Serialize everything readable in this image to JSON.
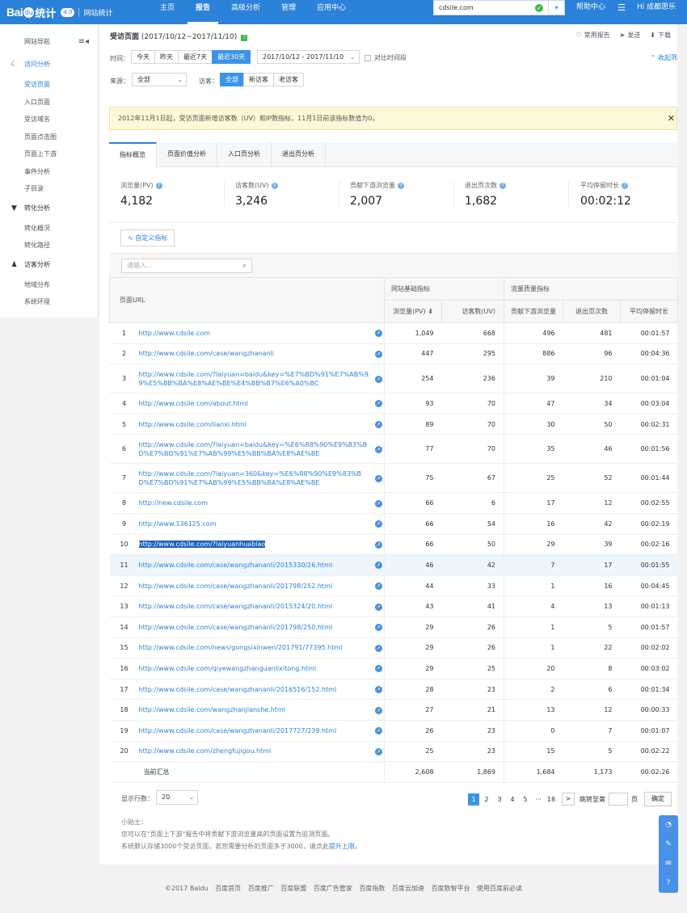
{
  "brand": {
    "bai": "Bai",
    "paw": "du",
    "tongji": "统计",
    "version": "4.0",
    "sub": "网站统计"
  },
  "topnav": [
    {
      "label": "主页"
    },
    {
      "label": "报告",
      "active": true
    },
    {
      "label": "高级分析"
    },
    {
      "label": "管理"
    },
    {
      "label": "应用中心"
    }
  ],
  "site": {
    "value": "cdsile.com"
  },
  "help": "帮助中心",
  "greeting": "Hi 成都思乐",
  "sidebar": {
    "title": "网站导航",
    "groups": [
      {
        "label": "访问分析",
        "icon": "moon-icon",
        "items": [
          "受访页面",
          "入口页面",
          "受访域名",
          "页面点击图",
          "页面上下游",
          "事件分析",
          "子目录"
        ]
      },
      {
        "label": "转化分析",
        "icon": "funnel-icon",
        "items": [
          "转化概况",
          "转化路径"
        ]
      },
      {
        "label": "访客分析",
        "icon": "user-icon",
        "items": [
          "地域分布",
          "系统环境"
        ]
      }
    ]
  },
  "header": {
    "title": "受访页面",
    "range": "(2017/10/12~2017/11/10)",
    "actions": [
      "常用报告",
      "发送",
      "下载"
    ],
    "collapse": "收起筛",
    "time_label": "时间：",
    "time_buttons": [
      "今天",
      "昨天",
      "最近7天",
      "最近30天"
    ],
    "date_range": "2017/10/12 - 2017/11/10",
    "compare": "对比时间段",
    "source_label": "来源：",
    "source_value": "全部",
    "visitor_label": "访客：",
    "visitor_buttons": [
      "全部",
      "新访客",
      "老访客"
    ]
  },
  "notice": "2012年11月1日起，受访页面新增访客数（UV）和IP数指标，11月1日前该指标数值为0。",
  "tabs": [
    "指标概览",
    "页面价值分析",
    "入口页分析",
    "退出页分析"
  ],
  "metrics": [
    {
      "label": "浏览量(PV)",
      "value": "4,182"
    },
    {
      "label": "访客数(UV)",
      "value": "3,246"
    },
    {
      "label": "贡献下游浏览量",
      "value": "2,007"
    },
    {
      "label": "退出页次数",
      "value": "1,682"
    },
    {
      "label": "平均停留时长",
      "value": "00:02:12"
    }
  ],
  "custom_metric": "自定义指标",
  "search_placeholder": "请输入...",
  "table": {
    "col_url": "页面URL",
    "group1": "网站基础指标",
    "group2": "流量质量指标",
    "cols": [
      "浏览量(PV)",
      "访客数(UV)",
      "贡献下游浏览量",
      "退出页次数",
      "平均停留时长"
    ],
    "rows": [
      {
        "idx": "1",
        "url": "http://www.cdsile.com",
        "pv": "1,049",
        "uv": "668",
        "down": "496",
        "exit": "481",
        "time": "00:01:57"
      },
      {
        "idx": "2",
        "url": "http://www.cdsile.com/case/wangzhananli",
        "pv": "447",
        "uv": "295",
        "down": "886",
        "exit": "96",
        "time": "00:04:36"
      },
      {
        "idx": "3",
        "url": "http://www.cdsile.com/?laiyuan=baidu&key=%E7%BD%91%E7%AB%99%E5%BB%BA%E8%AE%BE%E4%BB%B7%E6%A0%BC",
        "pv": "254",
        "uv": "236",
        "down": "39",
        "exit": "210",
        "time": "00:01:04"
      },
      {
        "idx": "4",
        "url": "http://www.cdsile.com/about.html",
        "pv": "93",
        "uv": "70",
        "down": "47",
        "exit": "34",
        "time": "00:03:04"
      },
      {
        "idx": "5",
        "url": "http://www.cdsile.com/lianxi.html",
        "pv": "89",
        "uv": "70",
        "down": "30",
        "exit": "50",
        "time": "00:02:31"
      },
      {
        "idx": "6",
        "url": "http://www.cdsile.com/?laiyuan=baidu&key=%E6%88%90%E9%83%BD%E7%BD%91%E7%AB%99%E5%BB%BA%E8%AE%BE",
        "pv": "77",
        "uv": "70",
        "down": "35",
        "exit": "46",
        "time": "00:01:56"
      },
      {
        "idx": "7",
        "url": "http://www.cdsile.com/?laiyuan=360&key=%E6%88%90%E9%83%BD%E7%BD%91%E7%AB%99%E5%BB%BA%E8%AE%BE",
        "pv": "75",
        "uv": "67",
        "down": "25",
        "exit": "52",
        "time": "00:01:44"
      },
      {
        "idx": "8",
        "url": "http://new.cdsile.com",
        "pv": "66",
        "uv": "6",
        "down": "17",
        "exit": "12",
        "time": "00:02:55"
      },
      {
        "idx": "9",
        "url": "http://www.136125.com",
        "pv": "66",
        "uv": "54",
        "down": "16",
        "exit": "42",
        "time": "00:02:19"
      },
      {
        "idx": "10",
        "url": "http://www.cdsile.com/?laiyuanhuabiao",
        "pv": "66",
        "uv": "50",
        "down": "29",
        "exit": "39",
        "time": "00:02:16"
      },
      {
        "idx": "11",
        "url": "http://www.cdsile.com/case/wangzhananli/2015330/26.html",
        "pv": "46",
        "uv": "42",
        "down": "7",
        "exit": "17",
        "time": "00:01:55"
      },
      {
        "idx": "12",
        "url": "http://www.cdsile.com/case/wangzhananli/201798/252.html",
        "pv": "44",
        "uv": "33",
        "down": "1",
        "exit": "16",
        "time": "00:04:45"
      },
      {
        "idx": "13",
        "url": "http://www.cdsile.com/case/wangzhananli/2015324/20.html",
        "pv": "43",
        "uv": "41",
        "down": "4",
        "exit": "13",
        "time": "00:01:13"
      },
      {
        "idx": "14",
        "url": "http://www.cdsile.com/case/wangzhananli/201798/250.html",
        "pv": "29",
        "uv": "26",
        "down": "1",
        "exit": "5",
        "time": "00:01:57"
      },
      {
        "idx": "15",
        "url": "http://www.cdsile.com/news/gongsixinwen/201791/77395.html",
        "pv": "29",
        "uv": "26",
        "down": "1",
        "exit": "22",
        "time": "00:02:02"
      },
      {
        "idx": "16",
        "url": "http://www.cdsile.com/qiyewangzhanguanlixitong.html",
        "pv": "29",
        "uv": "25",
        "down": "20",
        "exit": "8",
        "time": "00:03:02"
      },
      {
        "idx": "17",
        "url": "http://www.cdsile.com/case/wangzhananli/2016516/152.html",
        "pv": "28",
        "uv": "23",
        "down": "2",
        "exit": "6",
        "time": "00:01:34"
      },
      {
        "idx": "18",
        "url": "http://www.cdsile.com/wangzhanjianshe.html",
        "pv": "27",
        "uv": "21",
        "down": "13",
        "exit": "12",
        "time": "00:00:33"
      },
      {
        "idx": "19",
        "url": "http://www.cdsile.com/case/wangzhananli/2017727/239.html",
        "pv": "26",
        "uv": "23",
        "down": "0",
        "exit": "7",
        "time": "00:01:07"
      },
      {
        "idx": "20",
        "url": "http://www.cdsile.com/zhengfujigou.html",
        "pv": "25",
        "uv": "23",
        "down": "15",
        "exit": "5",
        "time": "00:02:22"
      }
    ],
    "total": {
      "label": "当前汇总",
      "pv": "2,608",
      "uv": "1,869",
      "down": "1,684",
      "exit": "1,173",
      "time": "00:02:26"
    }
  },
  "pager": {
    "rows_label": "显示行数：",
    "rows_value": "20",
    "pages": [
      "1",
      "2",
      "3",
      "4",
      "5"
    ],
    "ellipsis": "···",
    "last": "18",
    "next": ">",
    "jump_label": "跳转至第",
    "page_unit": "页",
    "ok": "确定"
  },
  "tips": {
    "title": "小贴士：",
    "line1": "您可以在\"页面上下游\"报告中将贡献下游浏览量高的页面设置为监测页面。",
    "line2_pre": "系统默认存储3000个受访页面，若您需要分析的页面多于3000，请点此",
    "line2_link": "提升上限",
    "line2_post": "。"
  },
  "footer": [
    "©2017 Baidu",
    "百度首页",
    "百度推广",
    "百度联盟",
    "百度广告管家",
    "百度指数",
    "百度云加速",
    "百度数智平台",
    "使用百度前必读"
  ]
}
